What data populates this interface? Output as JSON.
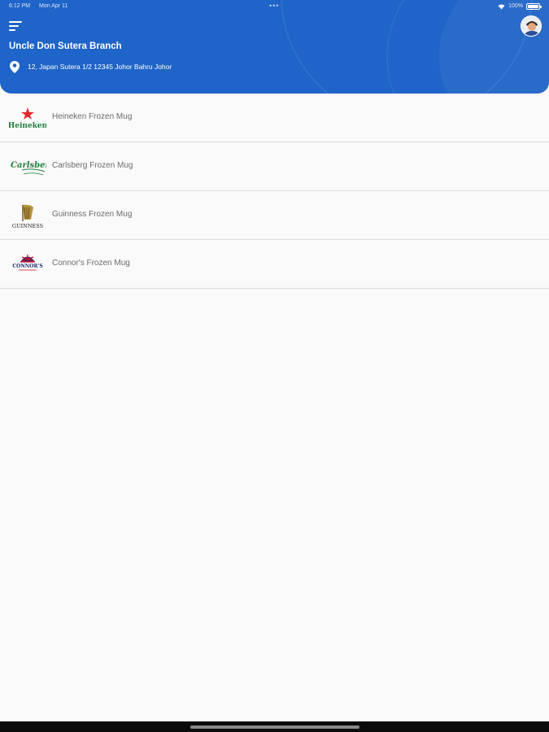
{
  "status_bar": {
    "time": "6:12 PM",
    "date": "Mon Apr 11",
    "dots": "•••",
    "battery": "100%"
  },
  "header": {
    "branch_name": "Uncle Don Sutera Branch",
    "address": "12, Japan Sutera 1/2 12345 Johor Bahru Johor",
    "background_color": "#1f64c8"
  },
  "products": [
    {
      "label": "Heineken Frozen Mug",
      "logo": "heineken-logo"
    },
    {
      "label": "Carlsberg Frozen Mug",
      "logo": "carlsberg-logo"
    },
    {
      "label": "Guinness Frozen Mug",
      "logo": "guinness-logo"
    },
    {
      "label": "Connor's Frozen Mug",
      "logo": "connors-logo"
    }
  ],
  "logos": {
    "heineken_text": "Heineken",
    "carlsberg_text": "Carlsberg",
    "guinness_text": "GUINNESS",
    "connors_text": "CONNOR'S"
  }
}
